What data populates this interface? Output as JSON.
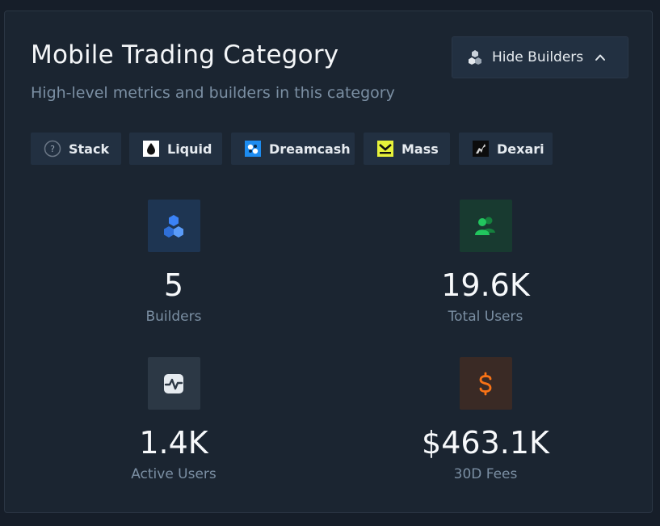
{
  "header": {
    "title": "Mobile Trading Category",
    "subtitle": "High-level metrics and builders in this category",
    "toggle_label": "Hide Builders"
  },
  "builders": [
    {
      "label": "Stack",
      "icon": "question-circle-icon"
    },
    {
      "label": "Liquid",
      "icon": "drop-icon"
    },
    {
      "label": "Dreamcash",
      "icon": "dreamcash-logo-icon"
    },
    {
      "label": "Mass",
      "icon": "mass-logo-icon"
    },
    {
      "label": "Dexari",
      "icon": "dexari-logo-icon"
    }
  ],
  "metrics": [
    {
      "value": "5",
      "label": "Builders",
      "icon": "cubes-icon",
      "color": "#3b82f6"
    },
    {
      "value": "19.6K",
      "label": "Total Users",
      "icon": "users-icon",
      "color": "#22c55e"
    },
    {
      "value": "1.4K",
      "label": "Active Users",
      "icon": "activity-icon",
      "color": "#e5e7eb"
    },
    {
      "value": "$463.1K",
      "label": "30D Fees",
      "icon": "dollar-icon",
      "color": "#f97316"
    }
  ]
}
